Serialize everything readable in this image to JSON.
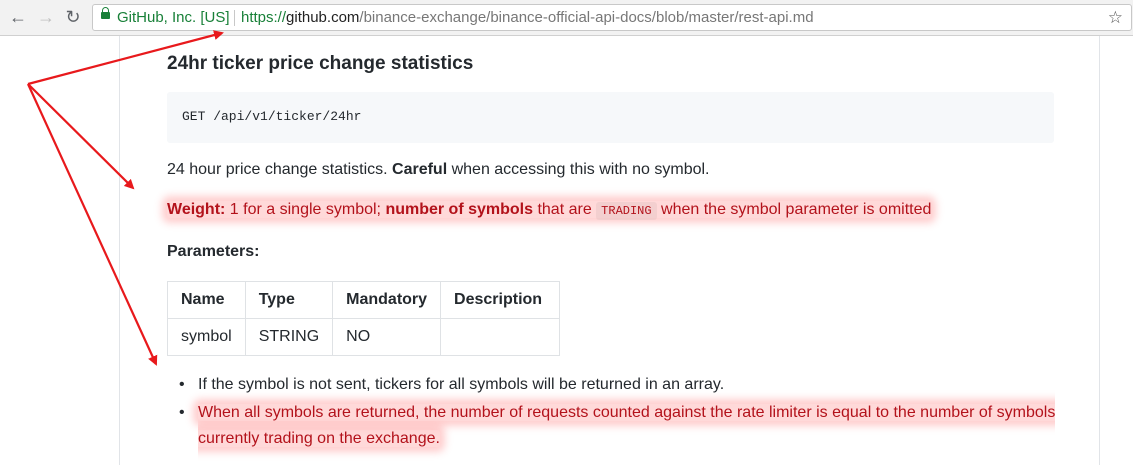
{
  "browser": {
    "back_icon": "arrow-left-icon",
    "forward_icon": "arrow-right-icon",
    "reload_icon": "reload-icon",
    "secure_owner": "GitHub, Inc. [US]",
    "url_protocol": "https://",
    "url_host": "github.com",
    "url_path": "/binance-exchange/binance-official-api-docs/blob/master/rest-api.md",
    "bookmark_icon": "star-icon"
  },
  "doc": {
    "heading": "24hr ticker price change statistics",
    "endpoint": "GET /api/v1/ticker/24hr",
    "desc_prefix": "24 hour price change statistics. ",
    "desc_bold": "Careful",
    "desc_suffix": " when accessing this with no symbol.",
    "weight_label": "Weight:",
    "weight_text1": " 1 for a single symbol; ",
    "weight_bold2": "number of symbols",
    "weight_text2": " that are ",
    "weight_code": "TRADING",
    "weight_text3": " when the symbol parameter is omitted",
    "params_label": "Parameters:",
    "table": {
      "headers": [
        "Name",
        "Type",
        "Mandatory",
        "Description"
      ],
      "rows": [
        [
          "symbol",
          "STRING",
          "NO",
          ""
        ]
      ]
    },
    "bullets": [
      "If the symbol is not sent, tickers for all symbols will be returned in an array.",
      "When all symbols are returned, the number of requests counted against the rate limiter is equal to the number of symbols currently trading on the exchange."
    ]
  },
  "colors": {
    "annotation": "#e8191c",
    "highlight": "#ff5050",
    "secure_green": "#188038"
  }
}
